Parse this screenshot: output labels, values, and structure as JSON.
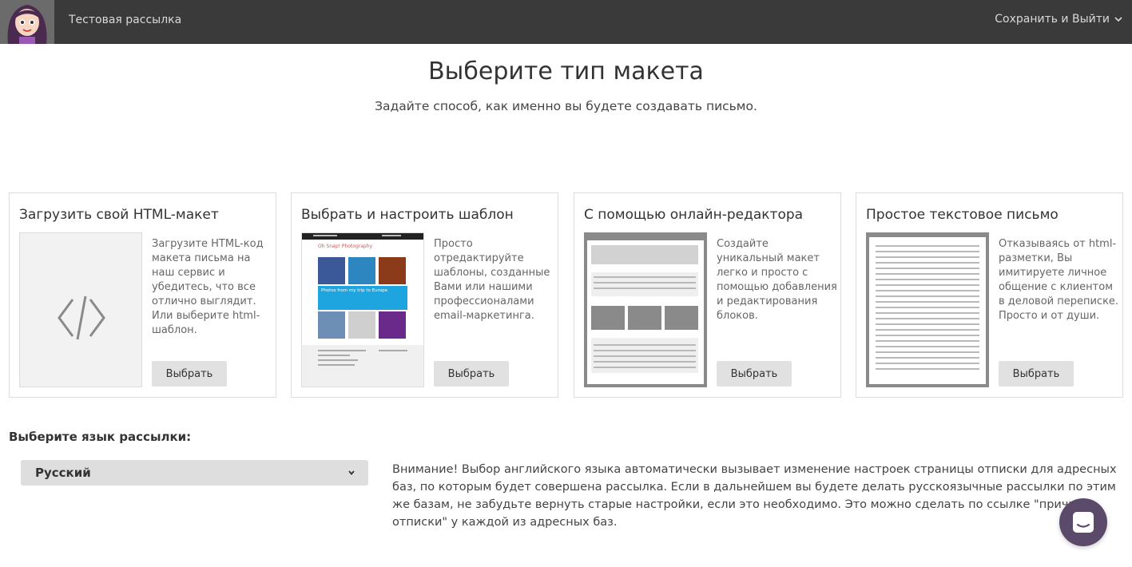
{
  "header": {
    "app_title": "Тестовая рассылка",
    "save_exit_label": "Сохранить и Выйти"
  },
  "main": {
    "title": "Выберите тип макета",
    "subtitle": "Задайте способ, как именно вы будете создавать письмо."
  },
  "cards": [
    {
      "title": "Загрузить свой HTML-макет",
      "description": "Загрузите HTML-код макета письма на наш сервис и убедитесь, что все отлично выглядит. Или выберите html-шаблон.",
      "button": "Выбрать",
      "thumb_icon": "code-icon"
    },
    {
      "title": "Выбрать и настроить шаблон",
      "description": "Просто отредактируйте шаблоны, созданные Вами или нашими профессионалами email-маркетинга.",
      "button": "Выбрать",
      "thumb_brand": "Oh Snap! Photography",
      "thumb_banner": "Photos from my trip to Europe"
    },
    {
      "title": "С помощью онлайн-редактора",
      "description": "Создайте уникальный макет легко и просто с помощью добавления и редактирования блоков.",
      "button": "Выбрать"
    },
    {
      "title": "Простое текстовое письмо",
      "description": "Отказываясь от html-разметки, Вы имитируете личное общение с клиентом в деловой переписке. Просто и от души.",
      "button": "Выбрать"
    }
  ],
  "language": {
    "label": "Выберите язык рассылки:",
    "selected": "Русский",
    "warning": "Внимание! Выбор английского языка автоматически вызывает изменение настроек страницы отписки для адресных баз, по которым будет совершена рассылка. Если в дальнейшем вы будете делать русскоязычные рассылки по этим же базам, не забудьте вернуть старые настройки, если это необходимо. Это можно сделать по ссылке \"причины отписки\" у каждой из адресных баз."
  },
  "colors": {
    "topbar": "#3a3a3a",
    "button": "#e1e1e1",
    "chat": "#5c4a6b",
    "template_banner": "#1ea5e0"
  }
}
